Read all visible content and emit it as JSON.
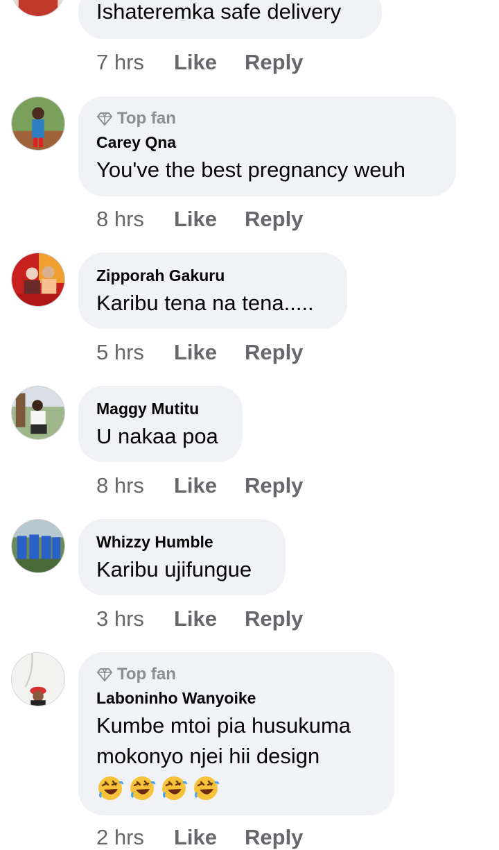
{
  "comments": [
    {
      "id": "c0",
      "top_fan": false,
      "author": "",
      "text_lines": [
        "Ishateremka safe delivery"
      ],
      "time": "7 hrs",
      "like": "Like",
      "reply": "Reply"
    },
    {
      "id": "c1",
      "top_fan": true,
      "badge": "Top fan",
      "author": "Carey Qna",
      "text_lines": [
        "You've the best pregnancy  weuh"
      ],
      "time": "8 hrs",
      "like": "Like",
      "reply": "Reply"
    },
    {
      "id": "c2",
      "top_fan": false,
      "author": "Zipporah Gakuru",
      "text_lines": [
        "Karibu tena na tena....."
      ],
      "time": "5 hrs",
      "like": "Like",
      "reply": "Reply"
    },
    {
      "id": "c3",
      "top_fan": false,
      "author": "Maggy Mutitu",
      "text_lines": [
        "U nakaa poa"
      ],
      "time": "8 hrs",
      "like": "Like",
      "reply": "Reply"
    },
    {
      "id": "c4",
      "top_fan": false,
      "author": "Whizzy Humble",
      "text_lines": [
        "Karibu ujifungue"
      ],
      "time": "3 hrs",
      "like": "Like",
      "reply": "Reply"
    },
    {
      "id": "c5",
      "top_fan": true,
      "badge": "Top fan",
      "author": "Laboninho Wanyoike",
      "text_lines": [
        "Kumbe mtoi pia husukuma",
        "mokonyo njei hii design"
      ],
      "emojis": [
        "rolling-on-floor-laughing",
        "rolling-on-floor-laughing",
        "rolling-on-floor-laughing",
        "rolling-on-floor-laughing"
      ],
      "time": "2 hrs",
      "like": "Like",
      "reply": "Reply"
    }
  ],
  "colors": {
    "bubble": "#f0f2f5",
    "meta_text": "#65676b",
    "badge_text": "#8a8d91",
    "body_text": "#050505"
  }
}
